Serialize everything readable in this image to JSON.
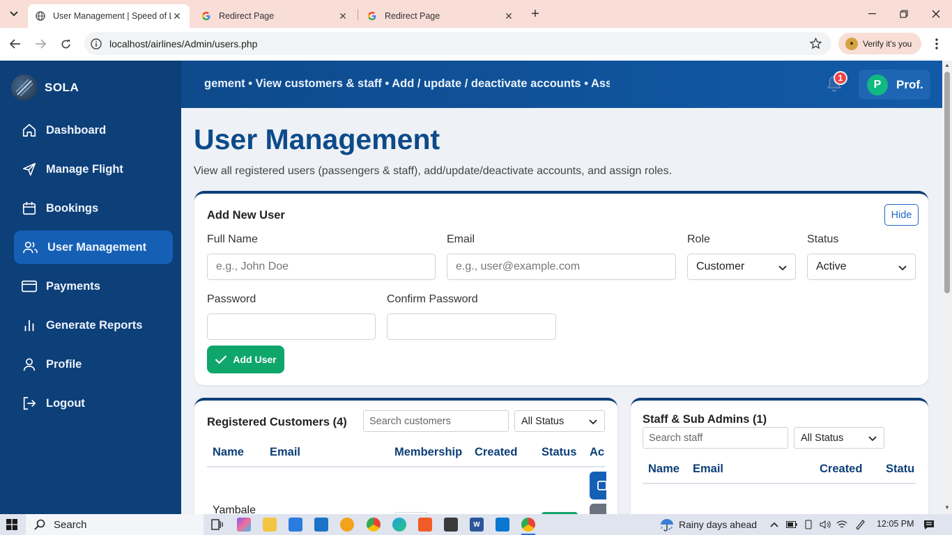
{
  "browser": {
    "tabs": [
      {
        "title": "User Management | Speed of Li",
        "active": true
      },
      {
        "title": "Redirect Page",
        "active": false
      },
      {
        "title": "Redirect Page",
        "active": false
      }
    ],
    "url": "localhost/airlines/Admin/users.php",
    "verify_label": "Verify it's you"
  },
  "sidebar": {
    "brand": "SOLA",
    "items": [
      {
        "label": "Dashboard",
        "icon": "home-icon"
      },
      {
        "label": "Manage Flight",
        "icon": "paper-plane-icon"
      },
      {
        "label": "Bookings",
        "icon": "calendar-icon"
      },
      {
        "label": "User Management",
        "icon": "users-icon",
        "active": true
      },
      {
        "label": "Payments",
        "icon": "credit-card-icon"
      },
      {
        "label": "Generate Reports",
        "icon": "bar-chart-icon"
      },
      {
        "label": "Profile",
        "icon": "user-icon"
      },
      {
        "label": "Logout",
        "icon": "logout-icon"
      }
    ]
  },
  "topbar": {
    "marquee": "gement • View customers & staff • Add / update / deactivate accounts • Ass",
    "notification_count": "1",
    "profile_initial": "P",
    "profile_name": "Prof."
  },
  "page": {
    "title": "User Management",
    "subtitle": "View all registered users (passengers & staff), add/update/deactivate accounts, and assign roles."
  },
  "add_user": {
    "heading": "Add New User",
    "hide_label": "Hide",
    "full_name_label": "Full Name",
    "full_name_placeholder": "e.g., John Doe",
    "email_label": "Email",
    "email_placeholder": "e.g., user@example.com",
    "role_label": "Role",
    "role_value": "Customer",
    "status_label": "Status",
    "status_value": "Active",
    "password_label": "Password",
    "confirm_password_label": "Confirm Password",
    "submit_label": "Add User"
  },
  "customers": {
    "heading": "Registered Customers (4)",
    "search_placeholder": "Search customers",
    "filter_value": "All Status",
    "columns": [
      "Name",
      "Email",
      "Membership",
      "Created",
      "Status",
      "Ac"
    ],
    "first_row_name": "Yambale"
  },
  "staff": {
    "heading": "Staff & Sub Admins (1)",
    "search_placeholder": "Search staff",
    "filter_value": "All Status",
    "columns": [
      "Name",
      "Email",
      "Created",
      "Statu"
    ]
  },
  "taskbar": {
    "search_label": "Search",
    "weather": "Rainy days ahead",
    "time": "12:05 PM"
  },
  "colors": {
    "sidebar": "#0d3f78",
    "active_nav": "#1560b5",
    "title": "#0d4a8a",
    "add_button": "#0fa66c"
  }
}
